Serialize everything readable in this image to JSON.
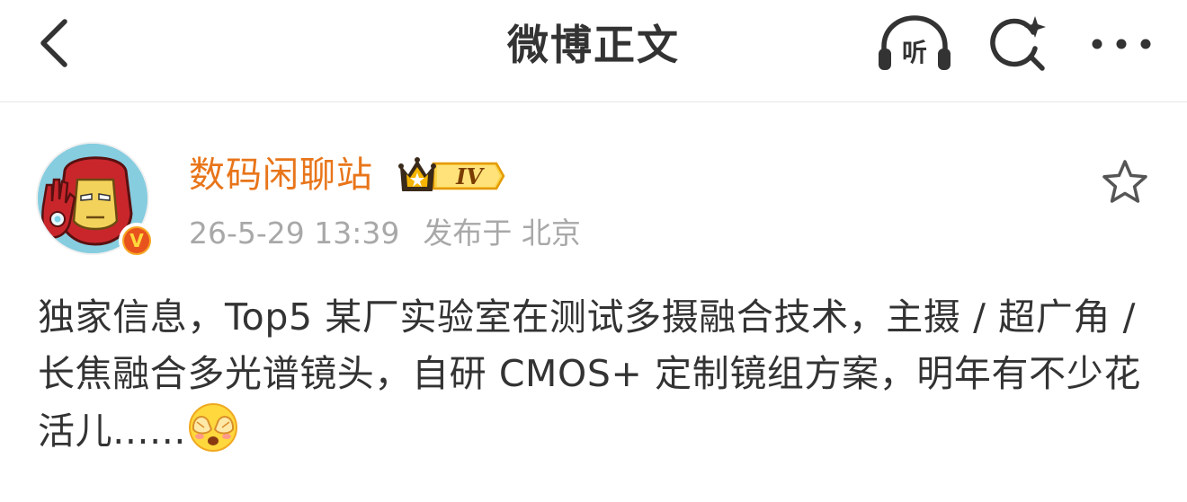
{
  "navbar": {
    "title": "微博正文",
    "back_icon": "chevron-left-icon",
    "listen_label": "听",
    "listen_icon": "headphones-icon",
    "search_icon": "search-sparkle-icon",
    "more_icon": "more-dots-icon"
  },
  "post": {
    "author": {
      "name": "数码闲聊站",
      "avatar_icon": "iron-man-avatar",
      "verified_badge": "V",
      "level_badge": "IV"
    },
    "time": "26-5-29 13:39",
    "location_prefix": "发布于",
    "location": "北京",
    "favorite_icon": "star-outline-icon",
    "text": "独家信息，Top5 某厂实验室在测试多摄融合技术，主摄 / 超广角 / 长焦融合多光谱镜头，自研 CMOS+ 定制镜组方案，明年有不少花活儿......",
    "trailing_emoji": "face-covering-eyes-emoji"
  },
  "colors": {
    "username": "#e8751a",
    "meta": "#a8a8a8",
    "body_text": "#333333",
    "title_text": "#333333",
    "verified_outer": "#f6a623",
    "verified_inner": "#e8531d",
    "level_gold": "#f4b400",
    "level_text": "#7a3d00"
  }
}
